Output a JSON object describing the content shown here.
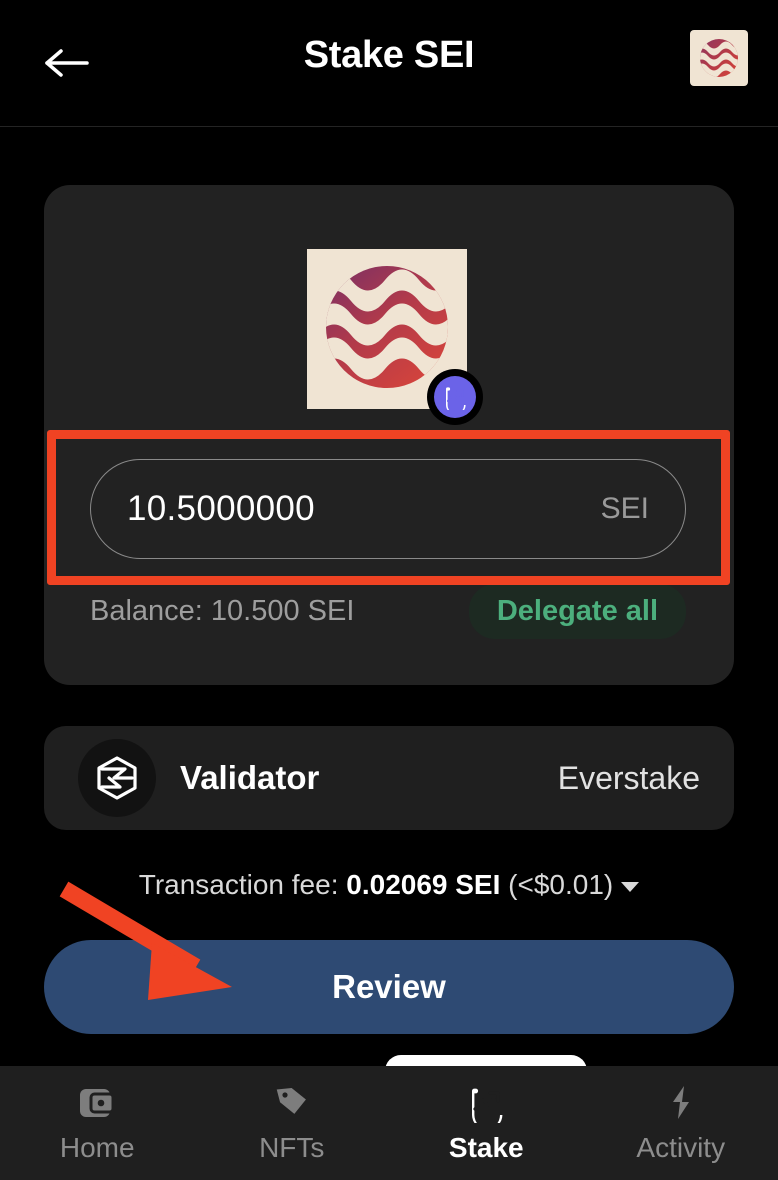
{
  "header": {
    "title": "Stake SEI",
    "back_icon": "arrow-left-icon",
    "avatar_icon": "sei-token-avatar"
  },
  "amount_card": {
    "token_icon": "sei-token-logo",
    "badge_icon": "stake-chart-badge-icon",
    "amount_value": "10.5000000",
    "amount_unit": "SEI",
    "balance_text": "Balance: 10.500 SEI",
    "delegate_all_label": "Delegate all"
  },
  "validator": {
    "icon": "everstake-hexagon-icon",
    "label": "Validator",
    "value": "Everstake"
  },
  "fee": {
    "prefix": "Transaction fee: ",
    "amount": "0.02069 SEI",
    "fiat": " (<$0.01)",
    "caret_icon": "chevron-down-icon"
  },
  "review_button": {
    "label": "Review"
  },
  "bottom_nav": {
    "items": [
      {
        "label": "Home",
        "icon": "wallet-icon",
        "active": false
      },
      {
        "label": "NFTs",
        "icon": "tag-icon",
        "active": false
      },
      {
        "label": "Stake",
        "icon": "stake-chart-icon",
        "active": true
      },
      {
        "label": "Activity",
        "icon": "lightning-bolt-icon",
        "active": false
      }
    ]
  },
  "annotations": {
    "highlight_color": "#f04323",
    "arrow_color": "#f04323",
    "highlight_target": "amount-input-field",
    "arrow_target": "review-button"
  },
  "colors": {
    "page_background": "#000000",
    "card_background": "#222222",
    "review_button": "#2e4a73",
    "delegate_all_text": "#4caf7d",
    "badge_purple": "#6b63e8",
    "token_cream": "#f0e4d3"
  }
}
